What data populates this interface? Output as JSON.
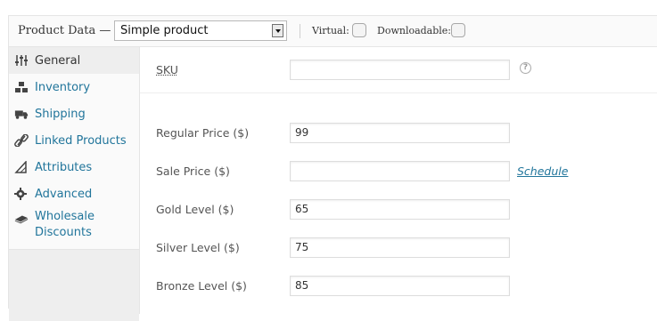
{
  "header": {
    "title": "Product Data —",
    "product_type": "Simple product",
    "virtual_label": "Virtual:",
    "downloadable_label": "Downloadable:"
  },
  "sidebar": {
    "items": [
      {
        "label": "General",
        "icon": "sliders-icon",
        "active": true
      },
      {
        "label": "Inventory",
        "icon": "boxes-icon",
        "active": false
      },
      {
        "label": "Shipping",
        "icon": "truck-icon",
        "active": false
      },
      {
        "label": "Linked Products",
        "icon": "link-icon",
        "active": false
      },
      {
        "label": "Attributes",
        "icon": "ruler-triangle-icon",
        "active": false
      },
      {
        "label": "Advanced",
        "icon": "gear-icon",
        "active": false
      },
      {
        "label_line1": "Wholesale",
        "label_line2": "Discounts",
        "icon": "money-icon",
        "active": false
      }
    ]
  },
  "fields": {
    "sku": {
      "label": "SKU",
      "value": ""
    },
    "regular_price": {
      "label": "Regular Price ($)",
      "value": "99"
    },
    "sale_price": {
      "label": "Sale Price ($)",
      "value": ""
    },
    "schedule_link": "Schedule",
    "gold_level": {
      "label": "Gold Level ($)",
      "value": "65"
    },
    "silver_level": {
      "label": "Silver Level ($)",
      "value": "75"
    },
    "bronze_level": {
      "label": "Bronze Level ($)",
      "value": "85"
    }
  },
  "help_glyph": "?",
  "colors": {
    "link": "#21759b",
    "panel_bg": "#fafafa",
    "active_tab": "#eeeeee"
  }
}
